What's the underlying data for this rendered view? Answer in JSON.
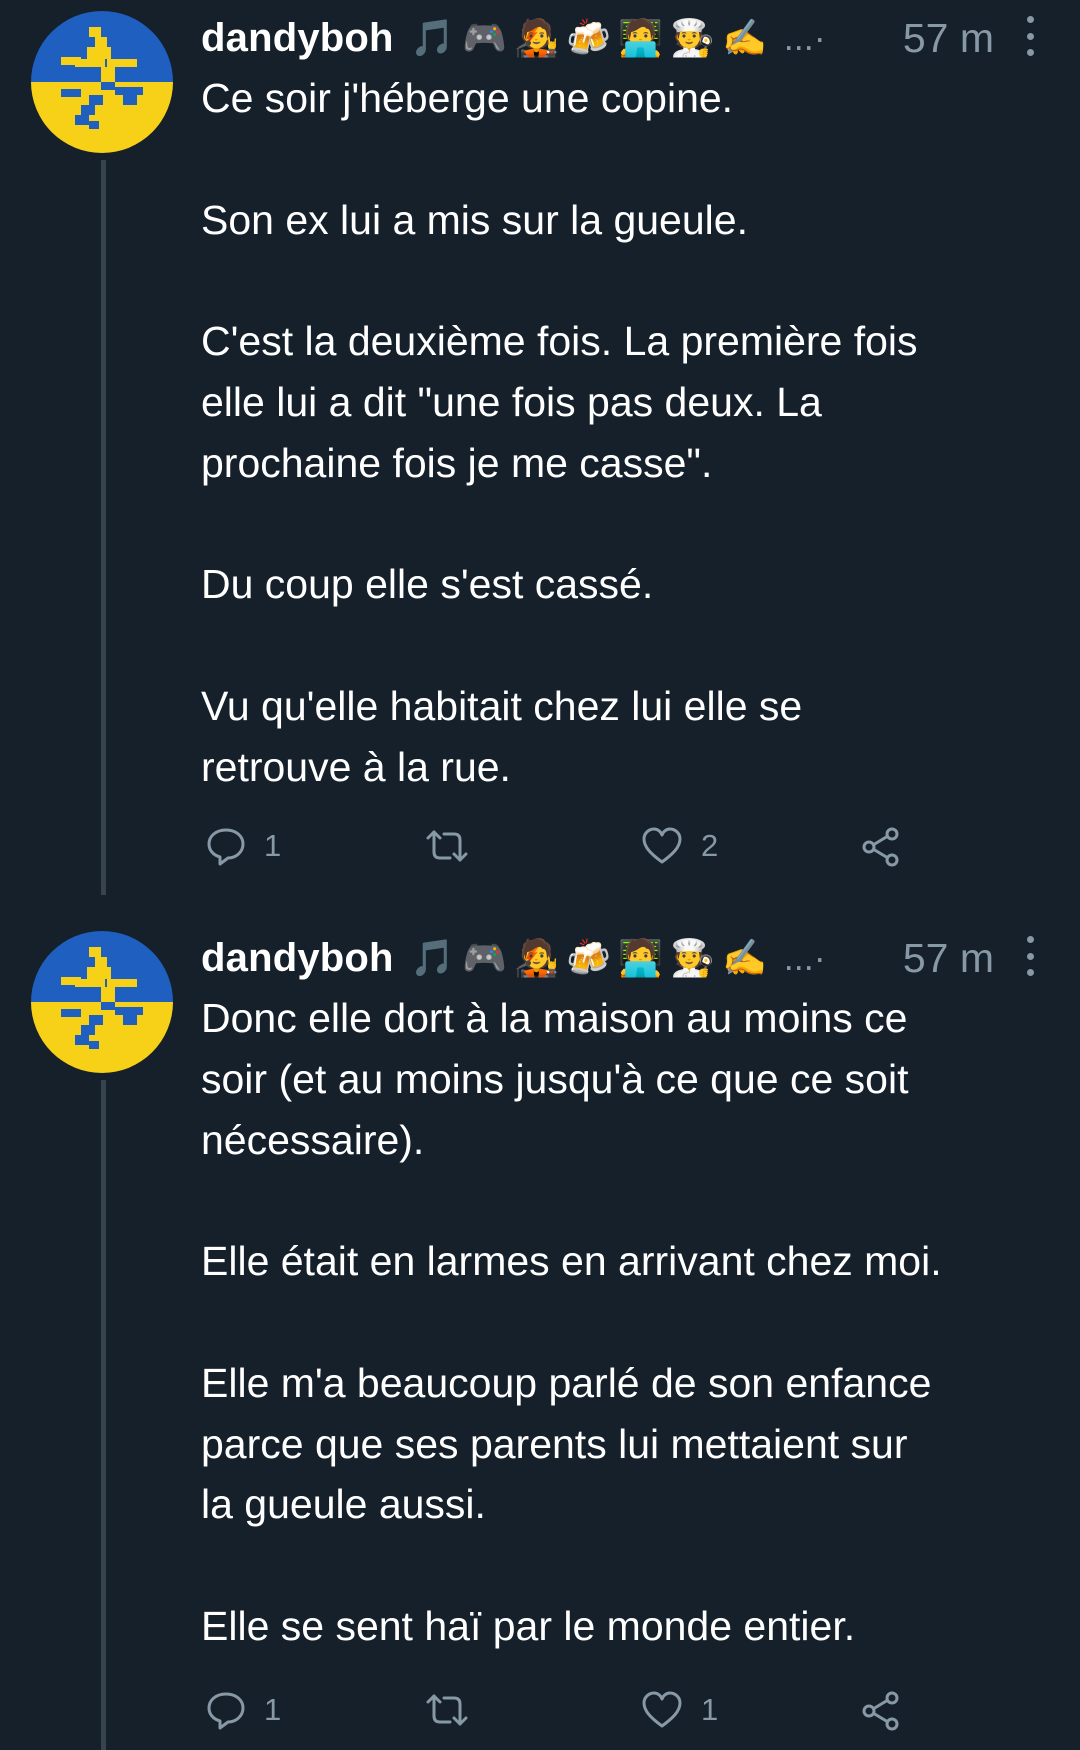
{
  "colors": {
    "background": "#15202b",
    "text": "#ffffff",
    "muted": "#8899a6",
    "thread_line": "#38444d",
    "avatar_blue": "#1f5fbf",
    "avatar_yellow": "#f7d117"
  },
  "tweets": [
    {
      "author": "dandyboh",
      "emojis": [
        "🎵",
        "🎮",
        "🧑‍🎤",
        "🍻",
        "🧑‍💻",
        "🧑‍🍳",
        "✍️"
      ],
      "ellipsis": "...·",
      "time": "57 m",
      "text": "Ce soir j'héberge une copine.\n\nSon ex lui a mis sur la gueule.\n\nC'est la deuxième fois. La première fois\nelle lui a dit \"une fois pas deux. La\nprochaine fois je me casse\".\n\nDu coup elle s'est cassé.\n\nVu qu'elle habitait chez lui elle se\nretrouve à la rue.",
      "replies": "1",
      "retweets": "",
      "likes": "2"
    },
    {
      "author": "dandyboh",
      "emojis": [
        "🎵",
        "🎮",
        "🧑‍🎤",
        "🍻",
        "🧑‍💻",
        "🧑‍🍳",
        "✍️"
      ],
      "ellipsis": "...·",
      "time": "57 m",
      "text": "Donc elle dort à la maison au moins ce\nsoir (et au moins jusqu'à ce que ce soit\nnécessaire).\n\nElle était en larmes en arrivant chez moi.\n\nElle m'a beaucoup parlé de son enfance\nparce que ses parents lui mettaient sur\nla gueule aussi.\n\nElle se sent haï par le monde entier.",
      "replies": "1",
      "retweets": "",
      "likes": "1"
    }
  ]
}
